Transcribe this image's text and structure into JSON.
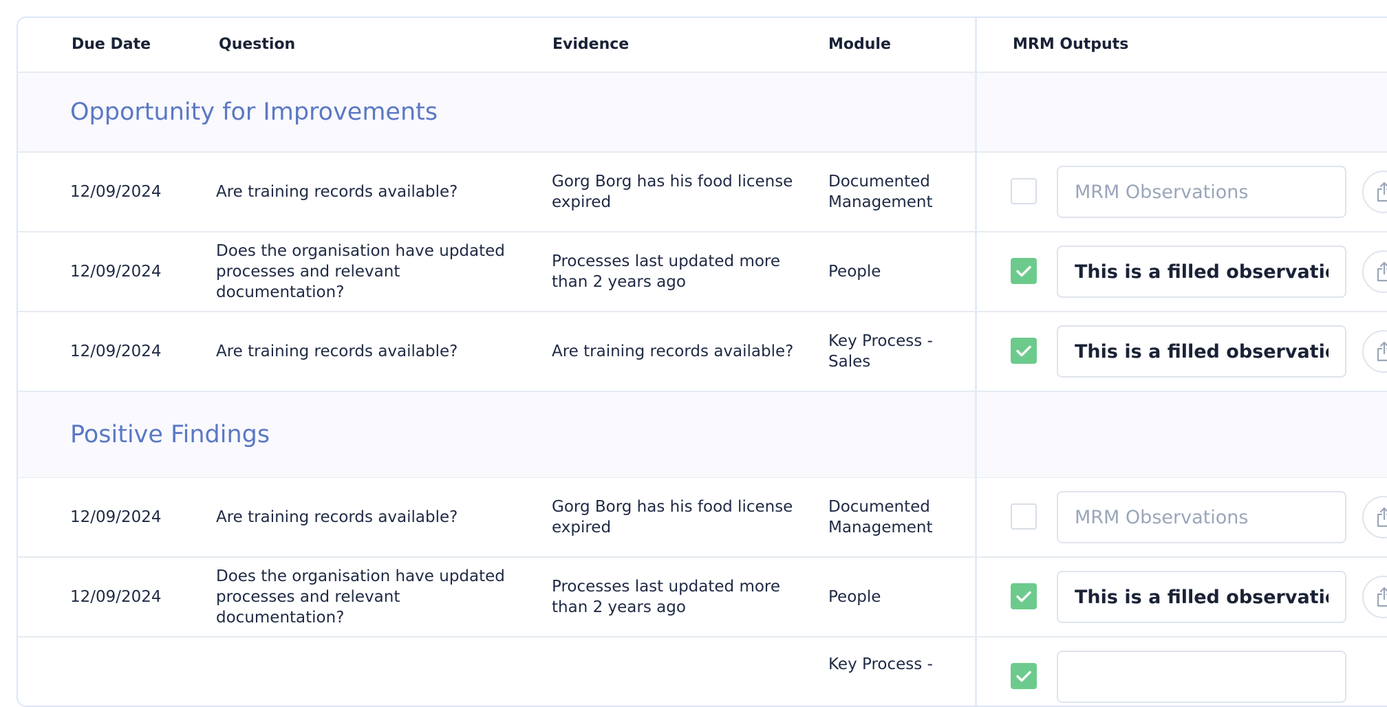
{
  "columns": {
    "due_date": "Due Date",
    "question": "Question",
    "evidence": "Evidence",
    "module": "Module",
    "mrm_outputs": "MRM Outputs"
  },
  "colors": {
    "group_title": "#5b78c4",
    "checkbox_checked": "#6ccb8c"
  },
  "observation_placeholder": "MRM Observations",
  "groups": [
    {
      "title": "Opportunity for Improvements",
      "rows": [
        {
          "due_date": "12/09/2024",
          "question": "Are training records available?",
          "evidence": "Gorg Borg has his food license expired",
          "module": "Documented Management",
          "checked": false,
          "observation": ""
        },
        {
          "due_date": "12/09/2024",
          "question": "Does the organisation have updated processes and relevant documentation?",
          "evidence": "Processes last updated more than 2 years ago",
          "module": "People",
          "checked": true,
          "observation": "This is a filled observation"
        },
        {
          "due_date": "12/09/2024",
          "question": "Are training records available?",
          "evidence": "Are training records available?",
          "module": "Key Process - Sales",
          "checked": true,
          "observation": "This is a filled observation"
        }
      ]
    },
    {
      "title": "Positive Findings",
      "rows": [
        {
          "due_date": "12/09/2024",
          "question": "Are training records available?",
          "evidence": "Gorg Borg has his food license expired",
          "module": "Documented Management",
          "checked": false,
          "observation": ""
        },
        {
          "due_date": "12/09/2024",
          "question": "Does the organisation have updated processes and relevant documentation?",
          "evidence": "Processes last updated more than 2 years ago",
          "module": "People",
          "checked": true,
          "observation": "This is a filled observation"
        },
        {
          "due_date": "",
          "question": "",
          "evidence": "",
          "module": "Key Process -",
          "checked": true,
          "observation": ""
        }
      ]
    }
  ]
}
